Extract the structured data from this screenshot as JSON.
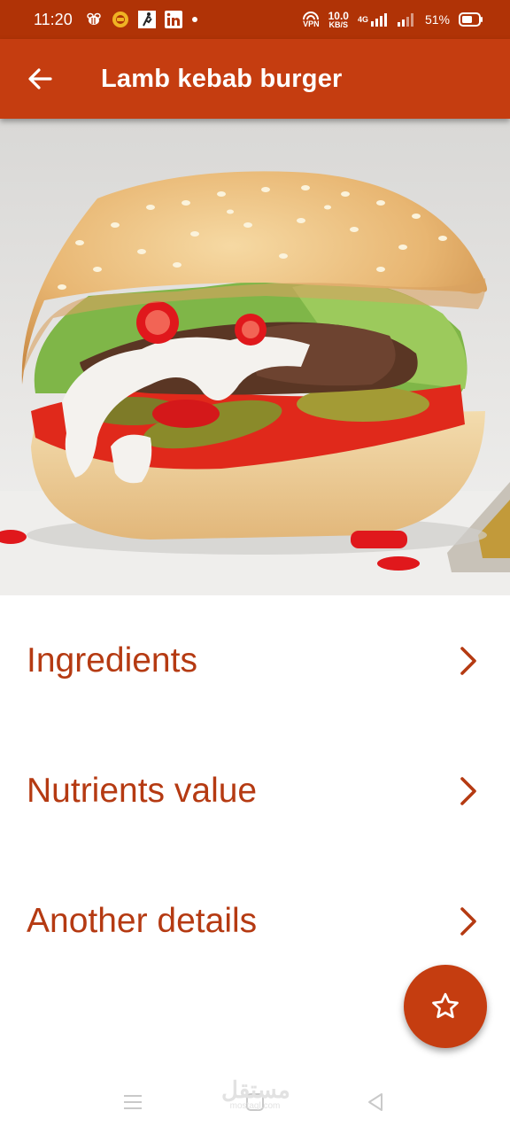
{
  "status_bar": {
    "time": "11:20",
    "vpn_label": "VPN",
    "speed_value": "10.0",
    "speed_unit": "KB/S",
    "network_label": "4G",
    "battery": "51%"
  },
  "app_bar": {
    "title": "Lamb kebab burger",
    "back_icon": "arrow-left-icon"
  },
  "hero_image": {
    "subject": "lamb kebab burger photo"
  },
  "sections": [
    {
      "label": "Ingredients",
      "icon": "chevron-right-icon"
    },
    {
      "label": "Nutrients value",
      "icon": "chevron-right-icon"
    },
    {
      "label": "Another details",
      "icon": "chevron-right-icon"
    }
  ],
  "fab": {
    "icon": "star-outline-icon"
  },
  "nav_bar": {
    "items": [
      "menu-icon",
      "home-icon",
      "back-triangle-icon"
    ]
  },
  "watermark": {
    "text": "مستقل",
    "sub": "mostaql.com"
  },
  "colors": {
    "primary": "#c53d10",
    "primary_dark": "#b03306",
    "text_accent": "#b53a12"
  }
}
